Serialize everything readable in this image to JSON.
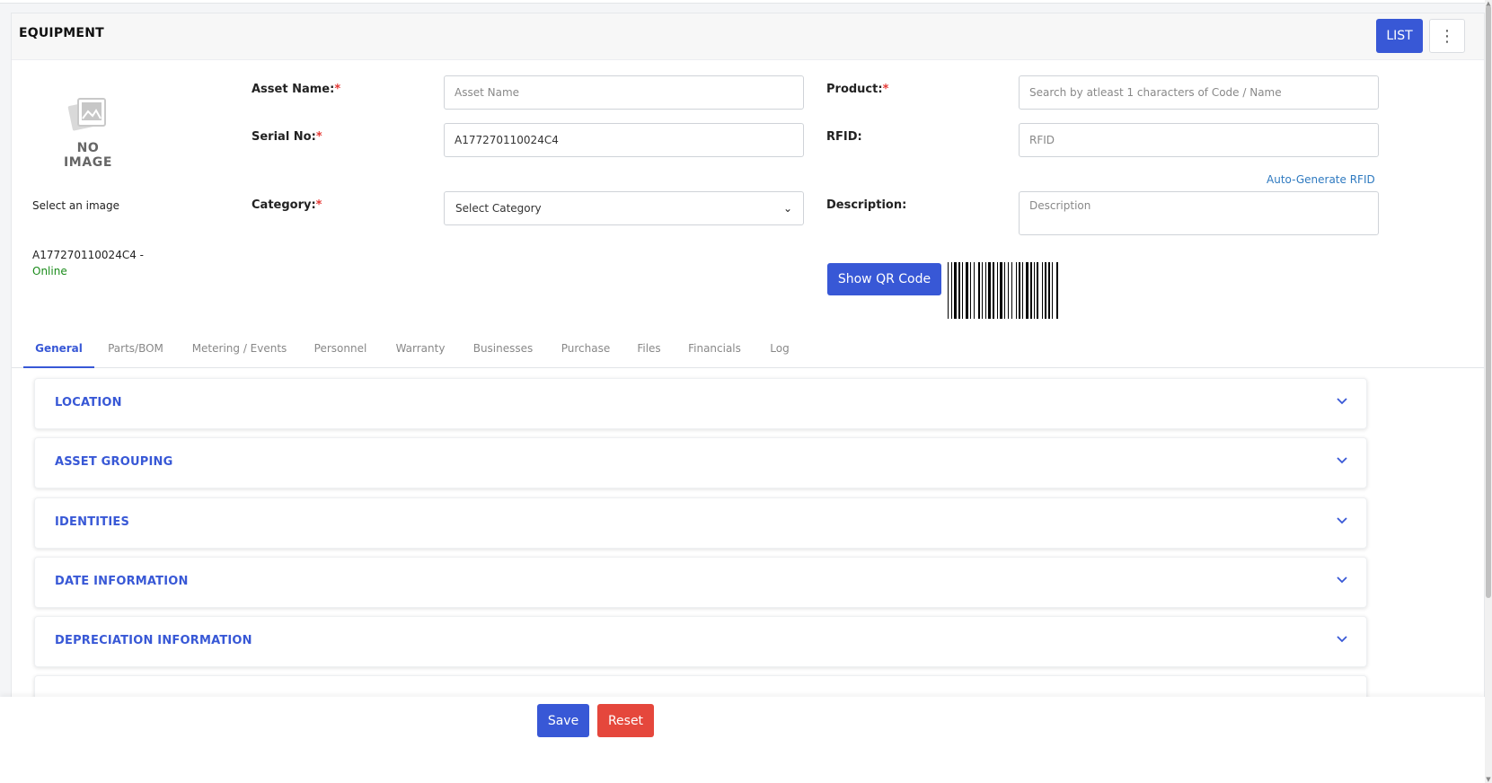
{
  "header": {
    "title": "EQUIPMENT",
    "list_label": "LIST",
    "more_icon": "kebab-vertical-icon"
  },
  "image": {
    "no_image_label": "NO IMAGE",
    "select_label": "Select an image",
    "serial": "A177270110024C4 -",
    "status": "Online"
  },
  "form": {
    "asset_name": {
      "label": "Asset Name:",
      "required": "*",
      "placeholder": "Asset Name",
      "value": ""
    },
    "serial_no": {
      "label": "Serial No:",
      "required": "*",
      "value": "A177270110024C4"
    },
    "category": {
      "label": "Category:",
      "required": "*",
      "selected": "Select Category"
    },
    "product": {
      "label": "Product:",
      "required": "*",
      "placeholder": "Search by atleast 1 characters of Code / Name"
    },
    "rfid": {
      "label": "RFID:",
      "placeholder": "RFID",
      "auto_generate": "Auto-Generate RFID"
    },
    "description": {
      "label": "Description:",
      "placeholder": "Description"
    },
    "qr_button": "Show QR Code"
  },
  "tabs": [
    {
      "label": "General",
      "active": true
    },
    {
      "label": "Parts/BOM"
    },
    {
      "label": "Metering / Events"
    },
    {
      "label": "Personnel"
    },
    {
      "label": "Warranty"
    },
    {
      "label": "Businesses"
    },
    {
      "label": "Purchase"
    },
    {
      "label": "Files"
    },
    {
      "label": "Financials"
    },
    {
      "label": "Log"
    }
  ],
  "sections": [
    "LOCATION",
    "ASSET GROUPING",
    "IDENTITIES",
    "DATE INFORMATION",
    "DEPRECIATION INFORMATION"
  ],
  "footer": {
    "save_label": "Save",
    "reset_label": "Reset"
  },
  "colors": {
    "primary": "#3858d6",
    "danger": "#e5473c",
    "success": "#1a8b1a",
    "link": "#2f7ac0",
    "required": "#e53935"
  }
}
